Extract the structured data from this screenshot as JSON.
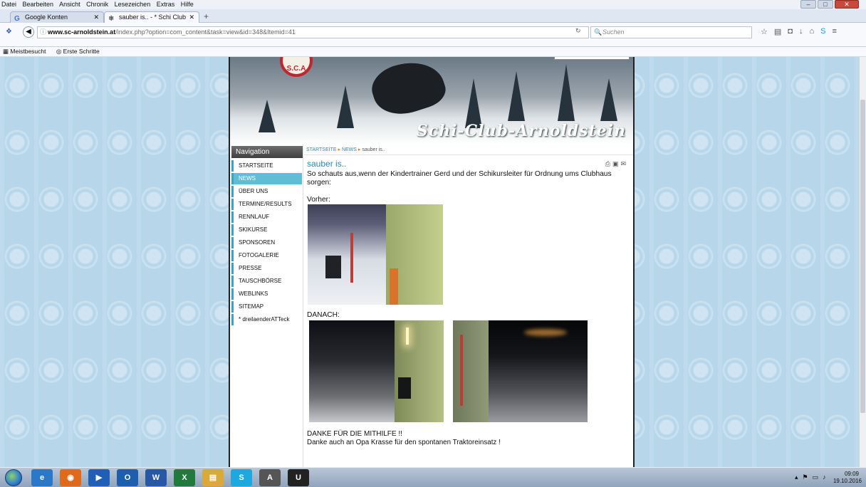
{
  "menubar": {
    "items": [
      "Datei",
      "Bearbeiten",
      "Ansicht",
      "Chronik",
      "Lesezeichen",
      "Extras",
      "Hilfe"
    ]
  },
  "tabs": [
    {
      "label": "Google Konten",
      "icon": "google-icon"
    },
    {
      "label": "sauber is.. - * Schi Club Arn...",
      "icon": "snowflake-icon"
    }
  ],
  "address": {
    "host": "www.sc-arnoldstein.at",
    "path": "/index.php?option=com_content&task=view&id=348&Itemid=41",
    "search_placeholder": "Suchen"
  },
  "bookmarks": [
    "Meistbesucht",
    "Erste Schritte"
  ],
  "banner": {
    "title": "Schi-Club-Arnoldstein",
    "logo_text": "S.C.A"
  },
  "sidebar": {
    "heading": "Navigation",
    "items": [
      {
        "label": "STARTSEITE",
        "active": false
      },
      {
        "label": "NEWS",
        "active": true
      },
      {
        "label": "ÜBER UNS",
        "active": false
      },
      {
        "label": "TERMINE/RESULTS",
        "active": false
      },
      {
        "label": "RENNLAUF",
        "active": false
      },
      {
        "label": "SKIKURSE",
        "active": false
      },
      {
        "label": "SPONSOREN",
        "active": false
      },
      {
        "label": "FOTOGALERIE",
        "active": false
      },
      {
        "label": "PRESSE",
        "active": false
      },
      {
        "label": "TAUSCHBÖRSE",
        "active": false
      },
      {
        "label": "WEBLINKS",
        "active": false
      },
      {
        "label": "SITEMAP",
        "active": false
      },
      {
        "label": "* dreilaenderATTeck",
        "active": false
      }
    ]
  },
  "breadcrumb": {
    "items": [
      "STARTSEITE",
      "NEWS",
      "sauber is.."
    ]
  },
  "article": {
    "title": "sauber is..",
    "intro": "So schauts aus,wenn der Kindertrainer Gerd und der Schikursleiter für Ordnung ums Clubhaus sorgen:",
    "before_label": "Vorher:",
    "after_label": "DANACH:",
    "thanks_heading": "DANKE FÜR DIE MITHILFE !!",
    "thanks_text": "Danke auch an Opa Krasse für den spontanen Traktoreinsatz !"
  },
  "taskbar": {
    "apps": [
      {
        "name": "ie-icon",
        "glyph": "e",
        "color": "#2b78c9"
      },
      {
        "name": "firefox-icon",
        "glyph": "◉",
        "color": "#e06a1b"
      },
      {
        "name": "media-player-icon",
        "glyph": "▶",
        "color": "#1f5fb5"
      },
      {
        "name": "outlook-icon",
        "glyph": "O",
        "color": "#1b5fae"
      },
      {
        "name": "word-icon",
        "glyph": "W",
        "color": "#2857a6"
      },
      {
        "name": "excel-icon",
        "glyph": "X",
        "color": "#1f7a3c"
      },
      {
        "name": "folder-icon",
        "glyph": "▤",
        "color": "#d9a93a"
      },
      {
        "name": "skype-icon",
        "glyph": "S",
        "color": "#1fa7e0"
      },
      {
        "name": "inkscape-icon",
        "glyph": "A",
        "color": "#555555"
      },
      {
        "name": "u-app-icon",
        "glyph": "U",
        "color": "#222222"
      }
    ],
    "time": "09:09",
    "date": "19.10.2016"
  }
}
